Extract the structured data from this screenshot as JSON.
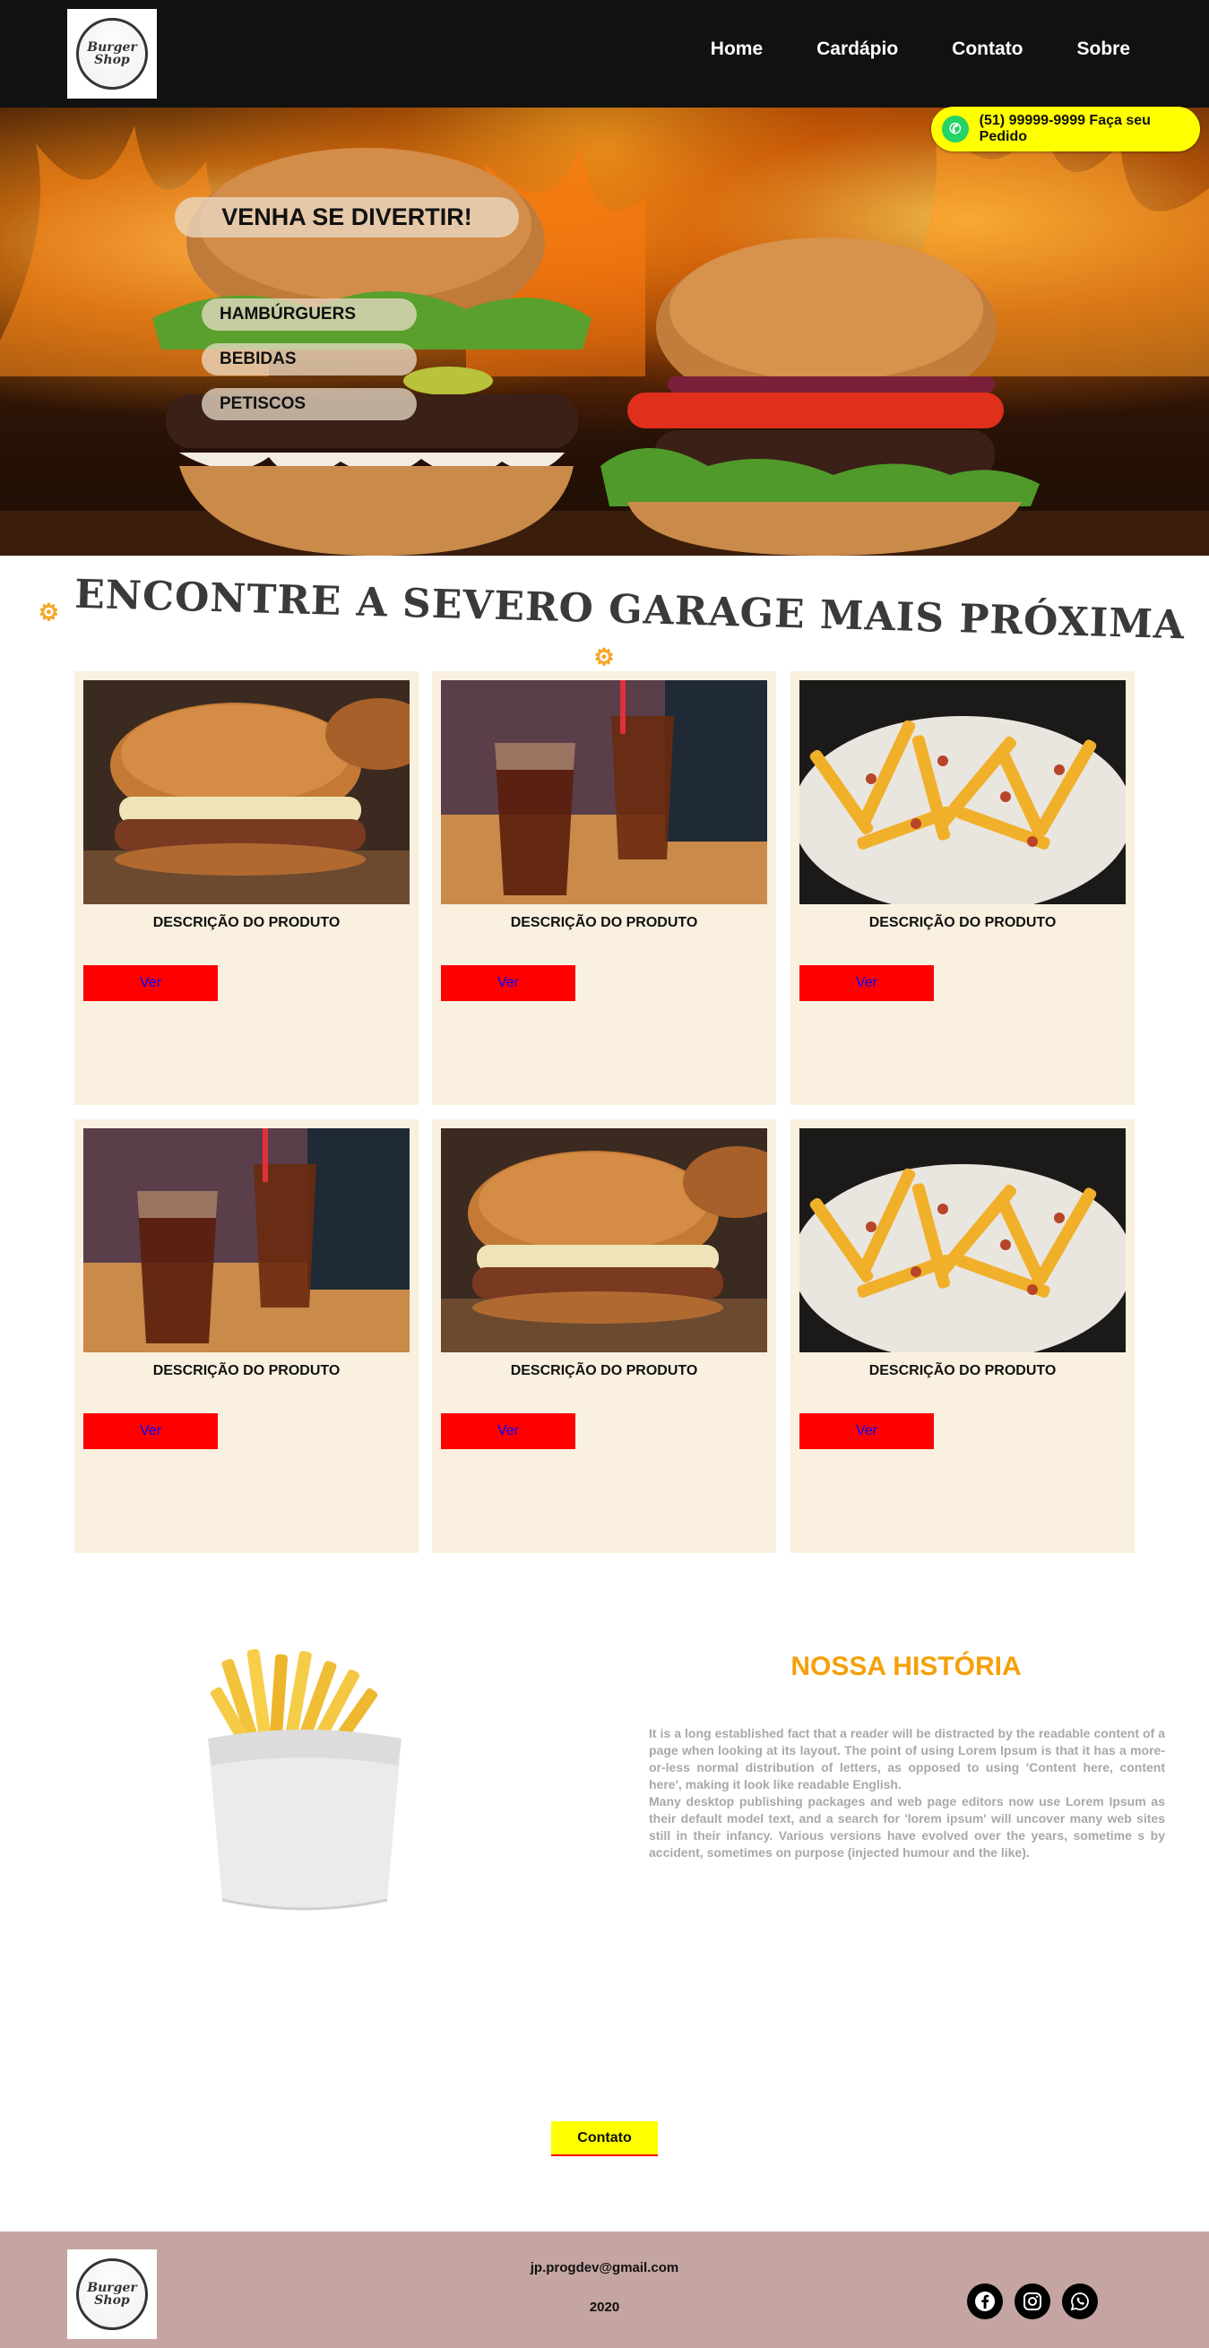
{
  "header": {
    "logo_text": [
      "Burger",
      "Shop"
    ],
    "nav": [
      "Home",
      "Cardápio",
      "Contato",
      "Sobre"
    ]
  },
  "hero": {
    "whatsapp": "(51) 99999-9999 Faça seu Pedido",
    "title": "VENHA SE DIVERTIR!",
    "menu": [
      "HAMBÚRGUERS",
      "BEBIDAS",
      "PETISCOS"
    ]
  },
  "section": {
    "title": "ENCONTRE A SEVERO GARAGE MAIS PRÓXIMA"
  },
  "products": [
    {
      "desc": "DESCRIÇÃO DO PRODUTO",
      "button": "Ver",
      "image": "burger"
    },
    {
      "desc": "DESCRIÇÃO DO PRODUTO",
      "button": "Ver",
      "image": "drink"
    },
    {
      "desc": "DESCRIÇÃO DO PRODUTO",
      "button": "Ver",
      "image": "fries"
    },
    {
      "desc": "DESCRIÇÃO DO PRODUTO",
      "button": "Ver",
      "image": "drink"
    },
    {
      "desc": "DESCRIÇÃO DO PRODUTO",
      "button": "Ver",
      "image": "burger"
    },
    {
      "desc": "DESCRIÇÃO DO PRODUTO",
      "button": "Ver",
      "image": "fries"
    }
  ],
  "history": {
    "title": "NOSSA HISTÓRIA",
    "p1": "It is a long established fact that a reader will be distracted by the readable content of a page when looking at its layout. The point of using Lorem Ipsum is that it has a more-or-less normal distribution of letters, as opposed to using 'Content here, content here', making it look like readable English.",
    "p2": "Many desktop publishing packages and web page editors now use Lorem Ipsum as their default model text, and a search for 'lorem ipsum' will uncover many web sites still in their infancy. Various versions have evolved over the years, sometime s by accident, sometimes on purpose (injected humour and the like)."
  },
  "contact_button": "Contato",
  "footer": {
    "email": "jp.progdev@gmail.com",
    "year": "2020",
    "social": [
      "facebook-icon",
      "instagram-icon",
      "whatsapp-icon"
    ]
  },
  "colors": {
    "header_bg": "#111111",
    "accent_yellow": "#ffff00",
    "button_red": "#ff0000",
    "button_text": "#0000ff",
    "card_bg": "#faf0df",
    "history_title": "#f5a00a",
    "footer_bg": "#c4a5a2"
  }
}
